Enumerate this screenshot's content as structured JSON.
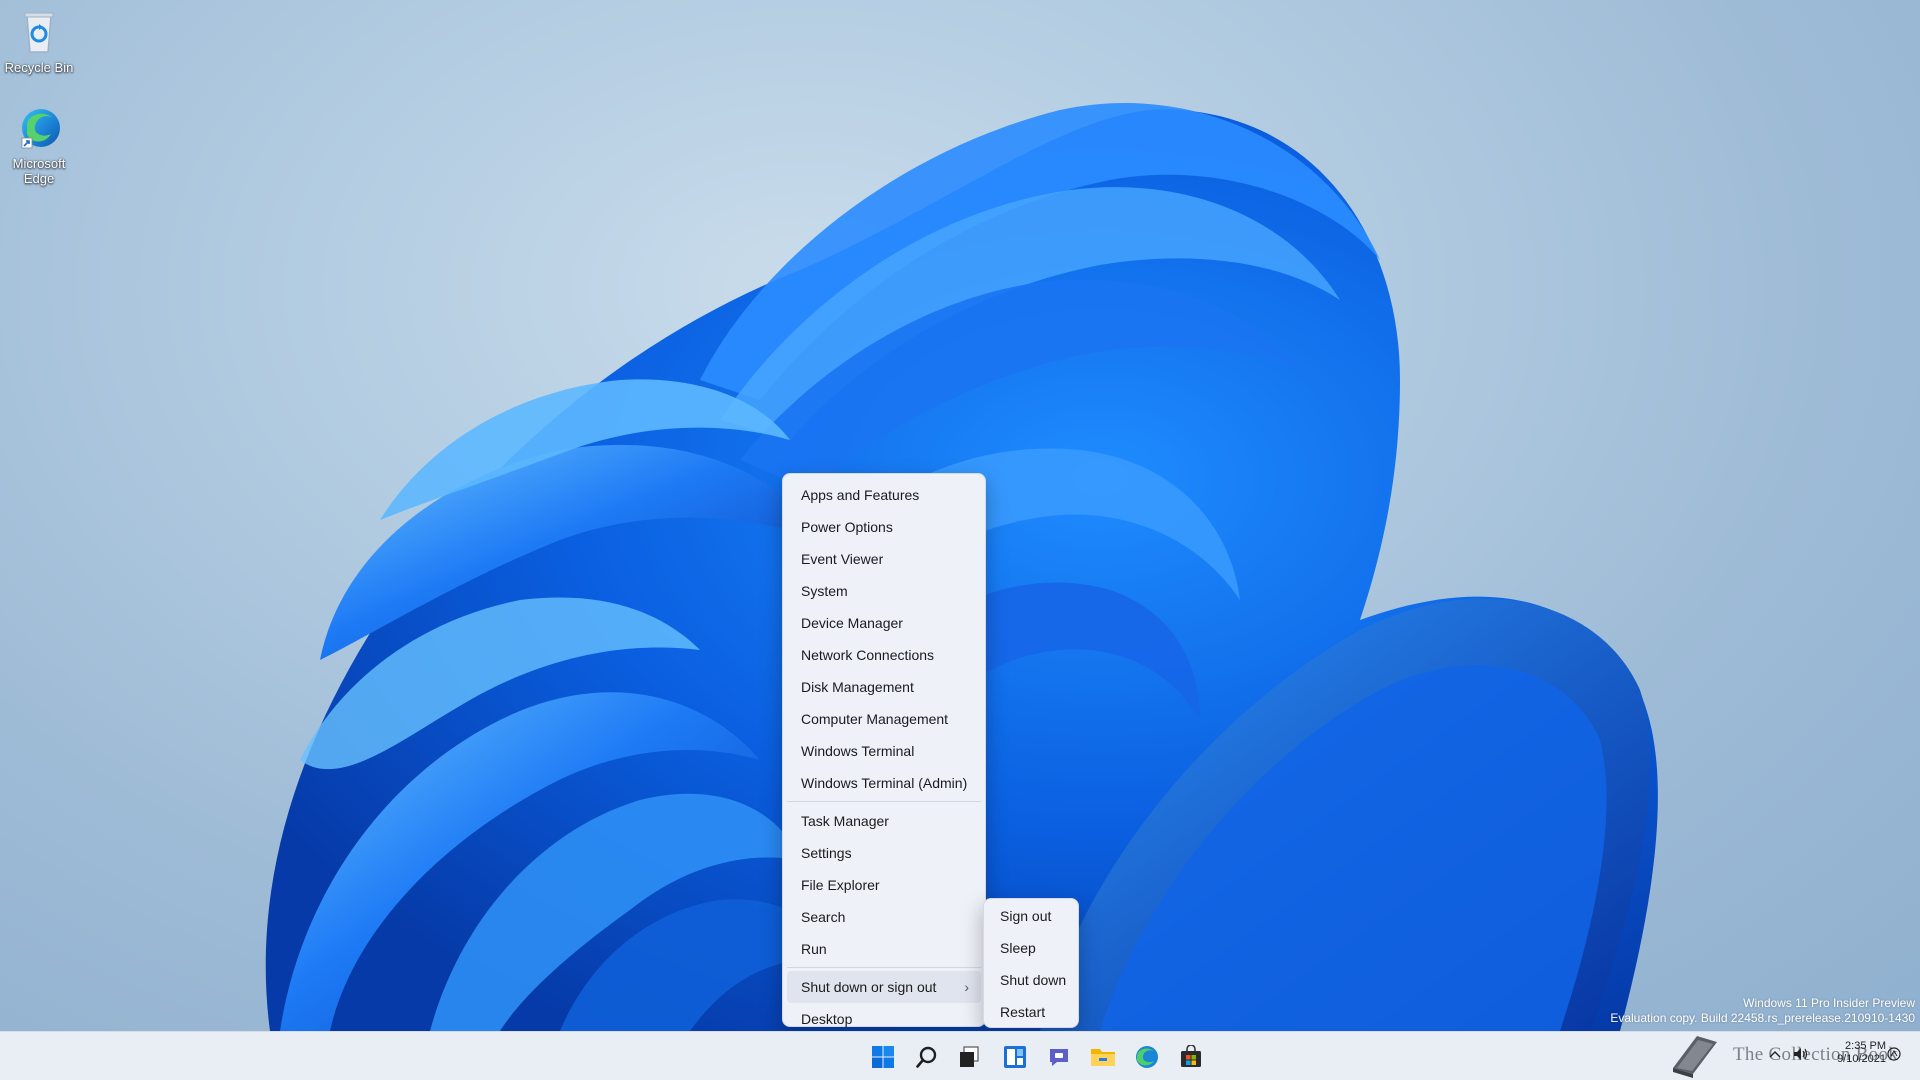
{
  "desktop": {
    "icons": [
      {
        "label": "Recycle Bin",
        "icon": "recycle-bin-icon"
      },
      {
        "label_line1": "Microsoft",
        "label_line2": "Edge",
        "icon": "edge-icon"
      }
    ]
  },
  "winx_menu": {
    "group1": [
      "Apps and Features",
      "Power Options",
      "Event Viewer",
      "System",
      "Device Manager",
      "Network Connections",
      "Disk Management",
      "Computer Management",
      "Windows Terminal",
      "Windows Terminal (Admin)"
    ],
    "group2": [
      "Task Manager",
      "Settings",
      "File Explorer",
      "Search",
      "Run"
    ],
    "shutdown_label": "Shut down or sign out",
    "shutdown_chevron": "›",
    "desktop_label": "Desktop"
  },
  "power_submenu": [
    "Sign out",
    "Sleep",
    "Shut down",
    "Restart"
  ],
  "watermark": {
    "line1": "Windows 11 Pro Insider Preview",
    "line2": "Evaluation copy. Build 22458.rs_prerelease.210910-1430"
  },
  "taskbar": {
    "icons": [
      "start-icon",
      "search-icon",
      "task-view-icon",
      "widgets-icon",
      "teams-chat-icon",
      "file-explorer-icon",
      "edge-icon",
      "store-icon"
    ],
    "time": "2:35 PM",
    "date": "9/10/2021",
    "brand": "The Collection Book",
    "accent": "#0067c0"
  }
}
